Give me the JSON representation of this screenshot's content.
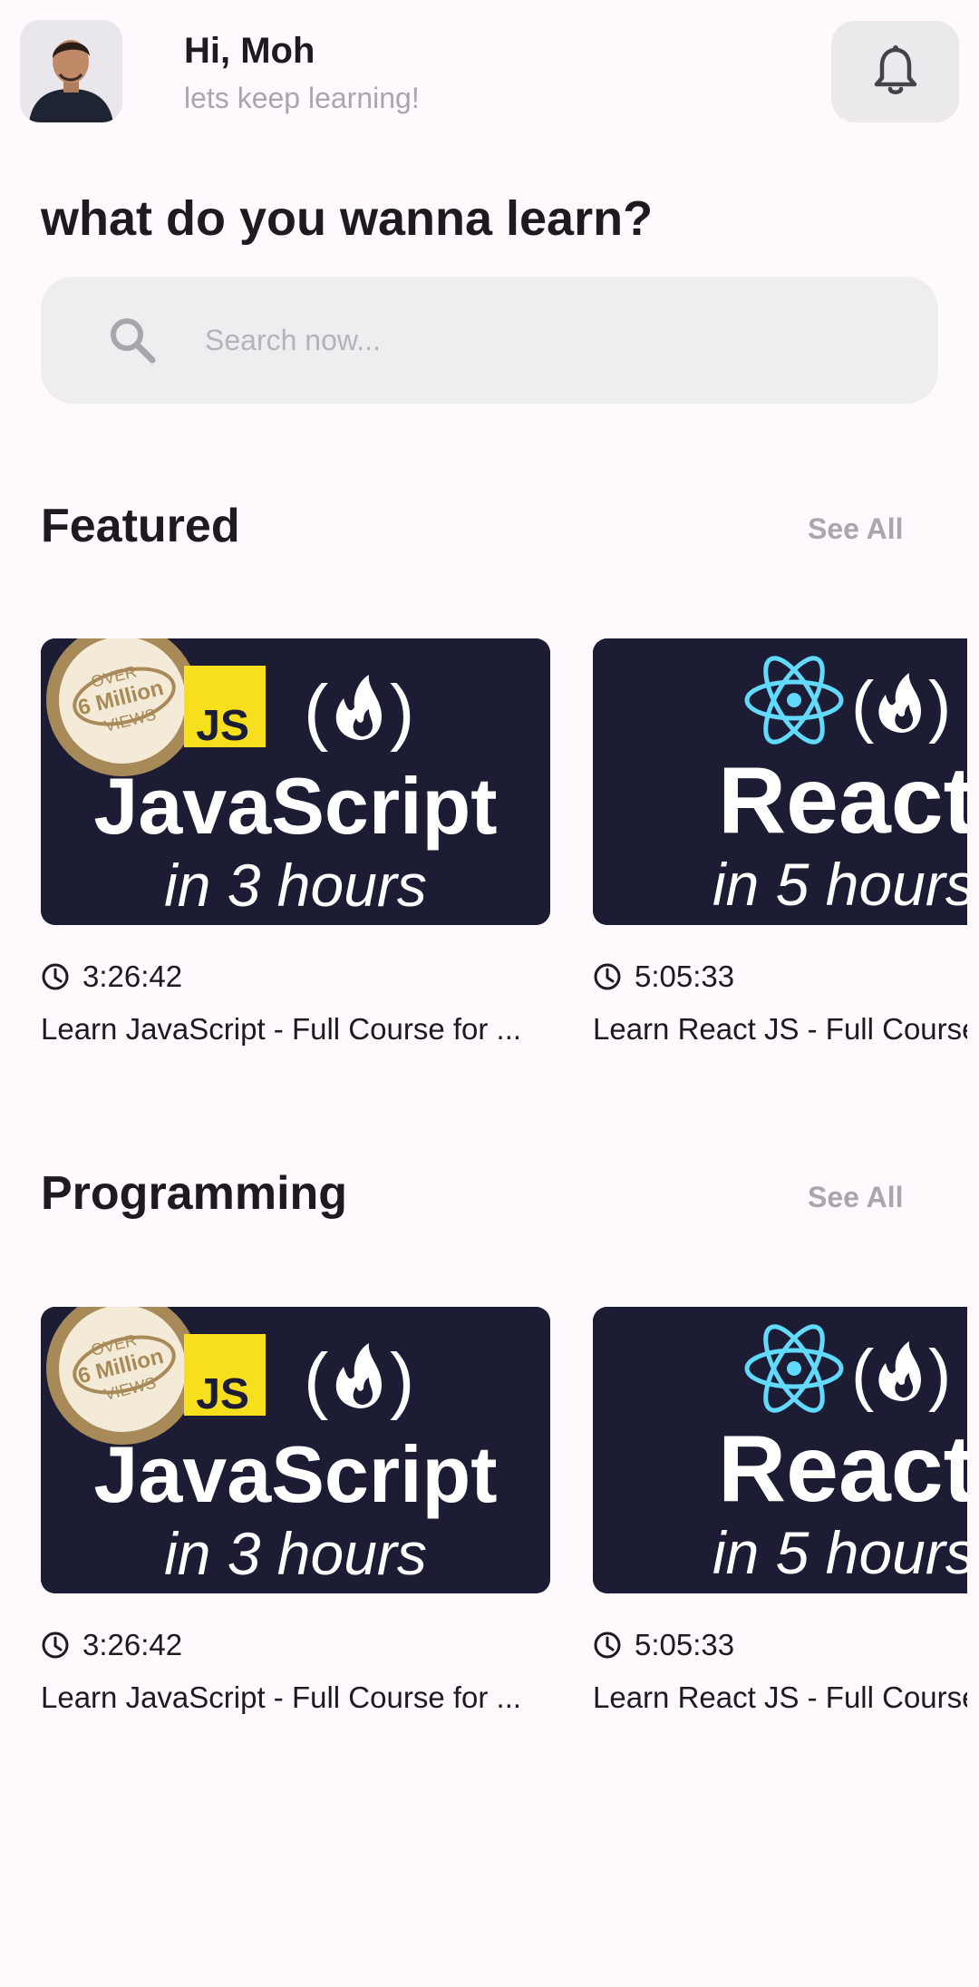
{
  "header": {
    "greeting": "Hi, Moh",
    "subtitle": "lets keep learning!"
  },
  "prompt": "what do you wanna learn?",
  "search": {
    "placeholder": "Search now..."
  },
  "sections": [
    {
      "title": "Featured",
      "see_all": "See All",
      "courses": [
        {
          "thumb": {
            "badge_top": "OVER",
            "badge_mid": "6 Million",
            "badge_bottom": "VIEWS",
            "logo": "JS",
            "headline": "JavaScript",
            "subline": "in 3 hours"
          },
          "duration": "3:26:42",
          "title": "Learn JavaScript - Full Course for ..."
        },
        {
          "thumb": {
            "headline": "React",
            "subline": "in 5 hours"
          },
          "duration": "5:05:33",
          "title": "Learn React JS - Full Course for Beginners"
        }
      ]
    },
    {
      "title": "Programming",
      "see_all": "See All",
      "courses": [
        {
          "thumb": {
            "badge_top": "OVER",
            "badge_mid": "6 Million",
            "badge_bottom": "VIEWS",
            "logo": "JS",
            "headline": "JavaScript",
            "subline": "in 3 hours"
          },
          "duration": "3:26:42",
          "title": "Learn JavaScript - Full Course for ..."
        },
        {
          "thumb": {
            "headline": "React",
            "subline": "in 5 hours"
          },
          "duration": "5:05:33",
          "title": "Learn React JS - Full Course for Beginners"
        }
      ]
    }
  ],
  "colors": {
    "background": "#fdf9fc",
    "thumbnail_bg": "#1c1c35",
    "js_yellow": "#f7df1e",
    "react_blue": "#61dafb",
    "badge_gold": "#a88a58"
  },
  "icons": [
    "bell-icon",
    "search-icon",
    "clock-icon",
    "fire-icon",
    "react-atom-icon"
  ]
}
